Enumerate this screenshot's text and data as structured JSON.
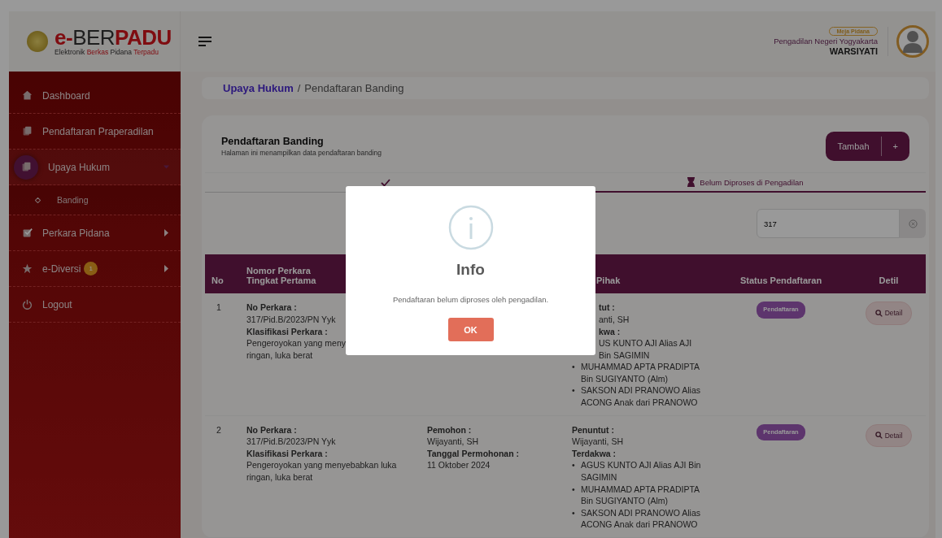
{
  "brand": {
    "title": [
      {
        "text": "e-",
        "accent": true
      },
      {
        "text": "BER",
        "accent": false
      },
      {
        "text": "PADU",
        "accent": true
      }
    ],
    "subtitle": [
      {
        "text": "Elektronik ",
        "accent": false
      },
      {
        "text": "Berkas ",
        "accent": true
      },
      {
        "text": "Pidana ",
        "accent": false
      },
      {
        "text": "Terpadu",
        "accent": true
      }
    ]
  },
  "header": {
    "role_badge": "Meja Pidana",
    "court": "Pengadilan Negeri Yogyakarta",
    "user": "WARSIYATI"
  },
  "sidebar": {
    "items": [
      {
        "label": "Dashboard",
        "selected": false
      },
      {
        "label": "Pendaftaran Praperadilan",
        "selected": false
      },
      {
        "label": "Upaya Hukum",
        "selected": true,
        "expanded": true,
        "children": [
          {
            "label": "Banding"
          }
        ]
      },
      {
        "label": "Perkara Pidana",
        "selected": false,
        "expanded": false
      },
      {
        "label": "e-Diversi",
        "selected": false,
        "expanded": false,
        "badge": "1"
      },
      {
        "label": "Logout",
        "selected": false
      }
    ]
  },
  "breadcrumb": {
    "parent": "Upaya Hukum",
    "separator": "/",
    "current": "Pendaftaran Banding"
  },
  "panel": {
    "title": "Pendaftaran Banding",
    "subtitle": "Halaman ini menampilkan data pendaftaran banding",
    "add_button": "Tambah",
    "add_symbol": "+"
  },
  "tabs": [
    {
      "selected": false
    },
    {
      "label": "Belum Diproses di Pengadilan",
      "selected": true
    }
  ],
  "search": {
    "value": "317"
  },
  "table": {
    "columns": [
      {
        "label": "No"
      },
      {
        "label": "Nomor Perkara Tingkat Pertama"
      },
      {},
      {
        "label": "Pihak",
        "clipped": true
      },
      {
        "label": "Status Pendaftaran"
      },
      {
        "label": "Detil"
      }
    ],
    "rows": [
      {
        "no": "1",
        "case": [
          {
            "kind": "label",
            "text": "No Perkara :"
          },
          {
            "kind": "value",
            "text": "317/Pid.B/2023/PN Yyk"
          },
          {
            "kind": "label",
            "text": "Klasifikasi Perkara :"
          },
          {
            "kind": "value",
            "text": "Pengeroyokan yang meny"
          },
          {
            "kind": "value",
            "text": "ringan, luka berat"
          }
        ],
        "parties": [
          {
            "kind": "label",
            "text": "tut :",
            "clipped": true
          },
          {
            "kind": "value",
            "text": "anti, SH",
            "clipped": true
          },
          {
            "kind": "label",
            "text": "kwa :",
            "clipped": true
          },
          {
            "kind": "bullet",
            "text": "US KUNTO AJI Alias AJI Bin SAGIMIN",
            "clipped": true
          },
          {
            "kind": "bullet",
            "marker": "•",
            "text": "MUHAMMAD APTA PRADIPTA Bin SUGIYANTO (Alm)",
            "clipped": false
          },
          {
            "kind": "bullet",
            "marker": "•",
            "text": "SAKSON ADI PRANOWO Alias ACONG Anak dari PRANOWO",
            "clipped": false
          }
        ],
        "status": "Pendaftaran",
        "detail": "Detail"
      },
      {
        "no": "2",
        "case": [
          {
            "kind": "label",
            "text": "No Perkara :"
          },
          {
            "kind": "value",
            "text": "317/Pid.B/2023/PN Yyk"
          },
          {
            "kind": "label",
            "text": "Klasifikasi Perkara :"
          },
          {
            "kind": "value",
            "text": "Pengeroyokan yang menyebabkan luka ringan, luka berat"
          }
        ],
        "applicant": [
          {
            "kind": "label",
            "text": "Pemohon :"
          },
          {
            "kind": "value",
            "text": "Wijayanti, SH"
          },
          {
            "kind": "label",
            "text": "Tanggal Permohonan :"
          },
          {
            "kind": "value",
            "text": "11 Oktober 2024"
          }
        ],
        "parties": [
          {
            "kind": "label",
            "text": "Penuntut :",
            "clipped": false
          },
          {
            "kind": "value",
            "text": "Wijayanti, SH",
            "clipped": false
          },
          {
            "kind": "label",
            "text": "Terdakwa :",
            "clipped": false
          },
          {
            "kind": "bullet",
            "marker": "•",
            "text": "AGUS KUNTO AJI Alias AJI Bin SAGIMIN",
            "clipped": false
          },
          {
            "kind": "bullet",
            "marker": "•",
            "text": "MUHAMMAD APTA PRADIPTA Bin SUGIYANTO (Alm)",
            "clipped": false
          },
          {
            "kind": "bullet",
            "marker": "•",
            "text": "SAKSON ADI PRANOWO Alias ACONG Anak dari PRANOWO",
            "clipped": false
          }
        ],
        "status": "Pendaftaran",
        "detail": "Detail"
      }
    ]
  },
  "dialog": {
    "title": "Info",
    "message": "Pendaftaran belum diproses oleh pengadilan.",
    "button": "OK"
  }
}
